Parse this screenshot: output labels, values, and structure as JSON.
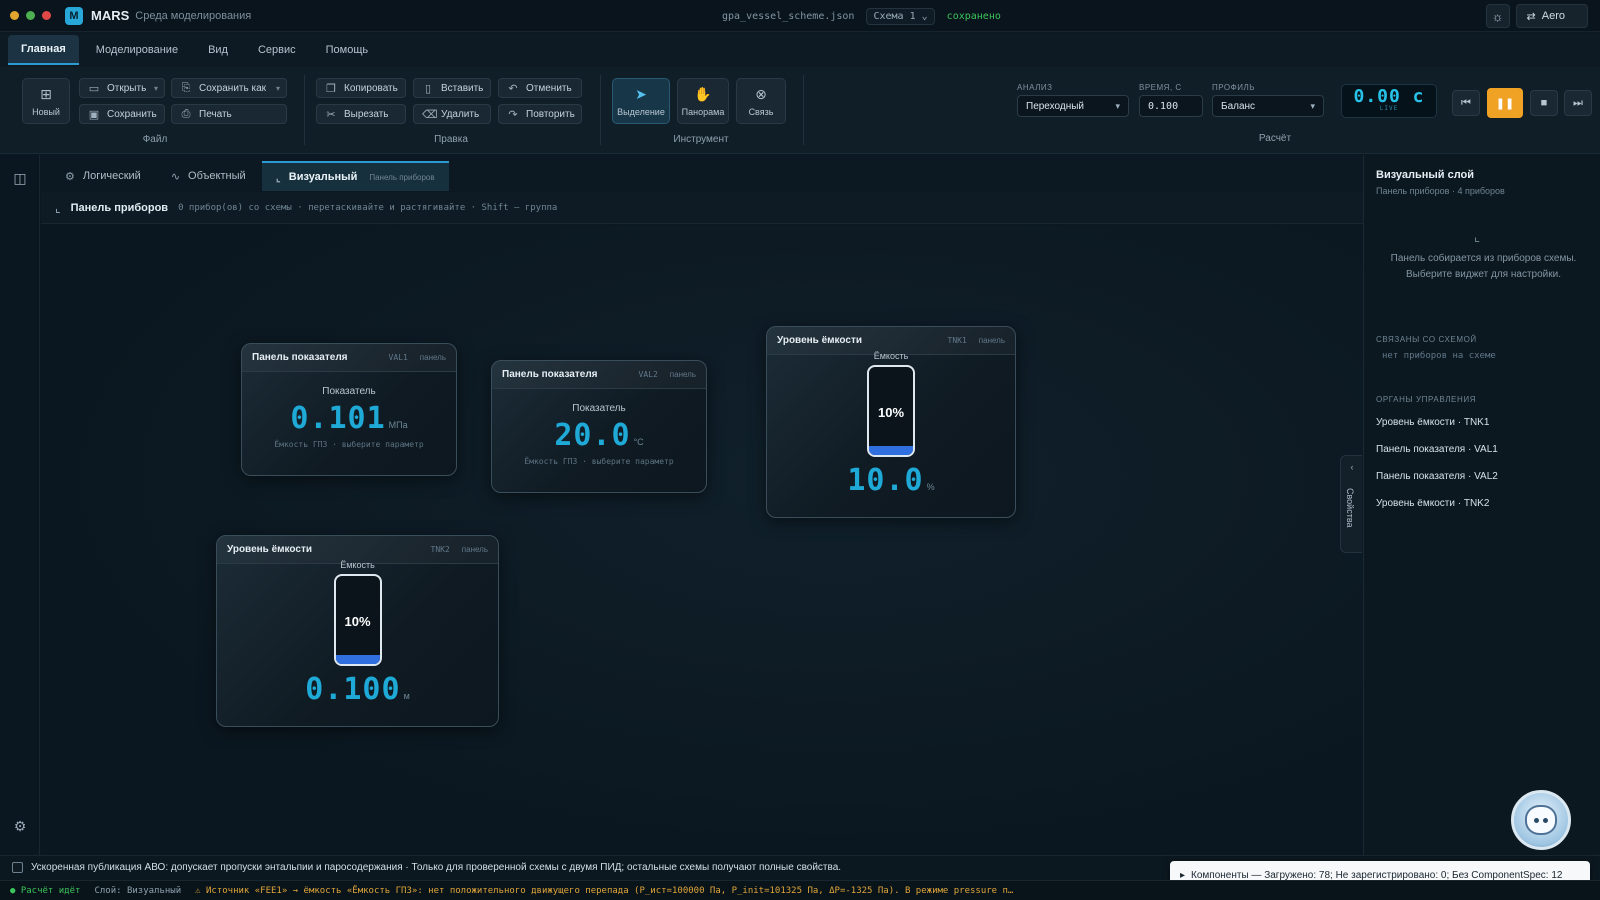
{
  "titlebar": {
    "traffic_colors": [
      "#e0a630",
      "#4caf50",
      "#e04848"
    ],
    "logo_letter": "M",
    "app_name": "MARS",
    "app_subtitle": "Среда моделирования",
    "file_name": "gpa_vessel_scheme.json",
    "schema": "Схема 1",
    "save_status": "сохранено",
    "theme_label": "Aero"
  },
  "menu": {
    "tabs": [
      "Главная",
      "Моделирование",
      "Вид",
      "Сервис",
      "Помощь"
    ],
    "active": "Главная"
  },
  "ribbon": {
    "file": {
      "group_label": "Файл",
      "new": "Новый",
      "open": "Открыть",
      "save_as": "Сохранить как",
      "save": "Сохранить",
      "print": "Печать"
    },
    "edit": {
      "group_label": "Правка",
      "copy": "Копировать",
      "paste": "Вставить",
      "undo": "Отменить",
      "cut": "Вырезать",
      "delete": "Удалить",
      "redo": "Повторить"
    },
    "tools": {
      "group_label": "Инструмент",
      "select": "Выделение",
      "pan": "Панорама",
      "link": "Связь"
    },
    "calc": {
      "group_label": "Расчёт",
      "analysis_label": "АНАЛИЗ",
      "analysis_value": "Переходный",
      "time_label": "ВРЕМЯ, С",
      "time_value": "0.100",
      "profile_label": "ПРОФИЛЬ",
      "profile_value": "Баланс",
      "timer_value": "0.00 с",
      "timer_live": "LIVE"
    }
  },
  "doc_tabs": {
    "logical": "Логический",
    "object": "Объектный",
    "visual": "Визуальный",
    "visual_sub": "Панель приборов"
  },
  "panel_header": {
    "title": "Панель приборов",
    "hint": "0 прибор(ов) со схемы · перетаскивайте и растягивайте · Shift — группа"
  },
  "widgets": {
    "val1": {
      "title": "Панель показателя",
      "id": "VAL1",
      "kind": "панель",
      "label": "Показатель",
      "value": "0.101",
      "unit": "МПа",
      "foot": "Ёмкость ГПЗ · выберите параметр"
    },
    "val2": {
      "title": "Панель показателя",
      "id": "VAL2",
      "kind": "панель",
      "label": "Показатель",
      "value": "20.0",
      "unit": "°C",
      "foot": "Ёмкость ГПЗ · выберите параметр"
    },
    "tnk1": {
      "title": "Уровень ёмкости",
      "id": "TNK1",
      "kind": "панель",
      "label": "Ёмкость",
      "percent_text": "10%",
      "fill_percent": 10,
      "value": "10.0",
      "unit": "%"
    },
    "tnk2": {
      "title": "Уровень ёмкости",
      "id": "TNK2",
      "kind": "панель",
      "label": "Ёмкость",
      "percent_text": "10%",
      "fill_percent": 10,
      "value": "0.100",
      "unit": "м"
    }
  },
  "right_panel": {
    "title": "Визуальный слой",
    "subtitle": "Панель приборов · 4 приборов",
    "hint": "Панель собирается из приборов схемы. Выберите виджет для настройки.",
    "linked_section": "СВЯЗАНЫ СО СХЕМОЙ",
    "linked_empty": "нет приборов на схеме",
    "controls_section": "ОРГАНЫ УПРАВЛЕНИЯ",
    "controls": [
      "Уровень ёмкости · TNK1",
      "Панель показателя · VAL1",
      "Панель показателя · VAL2",
      "Уровень ёмкости · TNK2"
    ],
    "properties_tab": "Свойства"
  },
  "notice": "Ускоренная публикация АВО: допускает пропуски энтальпии и паросодержания · Только для проверенной схемы с двумя ПИД; остальные схемы получают полные свойства.",
  "toast": "Компоненты — Загружено: 78; Не зарегистрировано: 0; Без ComponentSpec: 12",
  "status": {
    "running": "● Расчёт идёт",
    "layer": "Слой: Визуальный",
    "warning": "⚠ Источник «FEE1» → ёмкость «Ёмкость ГПЗ»: нет положительного движущего перепада (P_ист=100000 Па, P_init=101325 Па, ΔP=-1325 Па). В режиме pressure п…"
  },
  "icons": {
    "new": "file-plus-icon",
    "open": "folder-icon",
    "save_as": "save-as-icon",
    "save": "save-icon",
    "print": "printer-icon",
    "copy": "copy-icon",
    "paste": "clipboard-icon",
    "undo": "undo-icon",
    "cut": "scissors-icon",
    "delete": "trash-icon",
    "redo": "redo-icon",
    "select": "cursor-icon",
    "pan": "hand-icon",
    "link": "link-icon"
  }
}
